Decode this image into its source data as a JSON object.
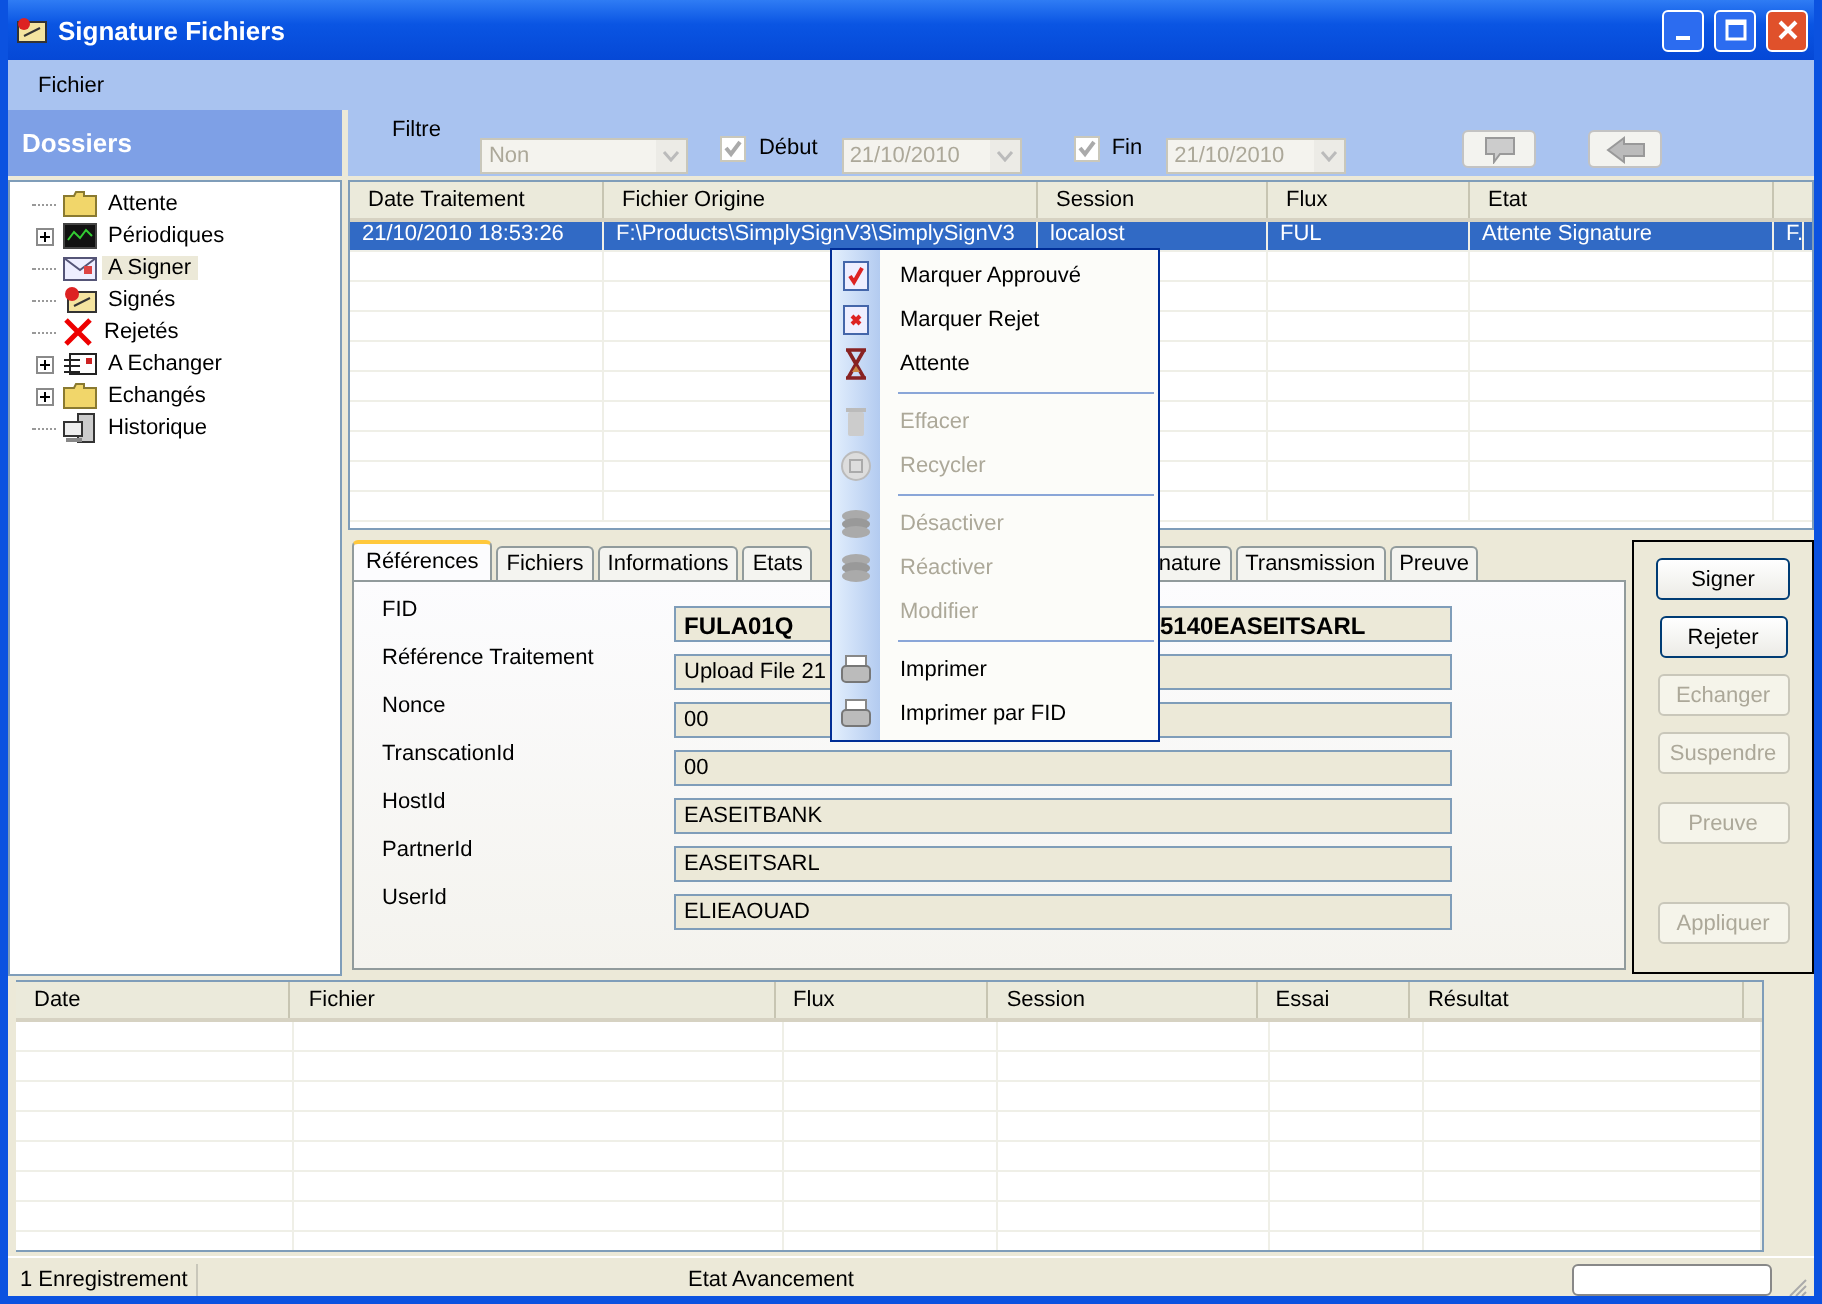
{
  "window": {
    "title": "Signature Fichiers"
  },
  "menu_bar": [
    "Fichier"
  ],
  "sidebar": {
    "title": "Dossiers",
    "items": [
      {
        "label": "Attente",
        "has_children": false,
        "selected": false
      },
      {
        "label": "Périodiques",
        "has_children": true,
        "selected": false
      },
      {
        "label": "A Signer",
        "has_children": false,
        "selected": true
      },
      {
        "label": "Signés",
        "has_children": false,
        "selected": false
      },
      {
        "label": "Rejetés",
        "has_children": false,
        "selected": false
      },
      {
        "label": "A Echanger",
        "has_children": true,
        "selected": false
      },
      {
        "label": "Echangés",
        "has_children": true,
        "selected": false
      },
      {
        "label": "Historique",
        "has_children": false,
        "selected": false
      }
    ]
  },
  "filter": {
    "label": "Filtre",
    "select": {
      "value": "Non",
      "disabled": true
    },
    "start": {
      "label": "Début",
      "checked": true,
      "date": "21/10/2010",
      "disabled": true
    },
    "end": {
      "label": "Fin",
      "checked": true,
      "date": "21/10/2010",
      "disabled": true
    }
  },
  "table": {
    "columns": [
      "Date Traitement",
      "Fichier Origine",
      "Session",
      "Flux",
      "Etat"
    ],
    "rows": [
      {
        "cells": [
          "21/10/2010 18:53:26",
          "F:\\Products\\SimplySignV3\\SimplySignV3",
          "localost",
          "FUL",
          "Attente Signature",
          "F."
        ],
        "selected": true
      }
    ]
  },
  "detail_tabs": [
    {
      "label": "Références",
      "selected": true
    },
    {
      "label": "Fichiers",
      "selected": false
    },
    {
      "label": "Informations",
      "selected": false
    },
    {
      "label": "Etats",
      "selected": false
    },
    {
      "label": "nature",
      "selected": false
    },
    {
      "label": "Transmission",
      "selected": false
    },
    {
      "label": "Preuve",
      "selected": false
    }
  ],
  "fields": [
    {
      "label": "FID",
      "value": "FULA01Q",
      "value_end": "5140EASEITSARL",
      "bold": true
    },
    {
      "label": "Référence Traitement",
      "value": "Upload File 21",
      "bold": false
    },
    {
      "label": "Nonce",
      "value": "00",
      "bold": false
    },
    {
      "label": "TranscationId",
      "value": "00",
      "bold": false
    },
    {
      "label": "HostId",
      "value": "EASEITBANK",
      "bold": false
    },
    {
      "label": "PartnerId",
      "value": "EASEITSARL",
      "bold": false
    },
    {
      "label": "UserId",
      "value": "ELIEAOUAD",
      "bold": false
    }
  ],
  "actions": [
    {
      "label": "Signer",
      "disabled": false
    },
    {
      "label": "Rejeter",
      "disabled": false
    },
    {
      "label": "Echanger",
      "disabled": true
    },
    {
      "label": "Suspendre",
      "disabled": true
    },
    {
      "label": "Preuve",
      "disabled": true
    },
    {
      "label": "Appliquer",
      "disabled": true
    }
  ],
  "log_table": {
    "columns": [
      "Date",
      "Fichier",
      "Flux",
      "Session",
      "Essai",
      "Résultat"
    ]
  },
  "status_bar": {
    "count": "1 Enregistrement",
    "progress_label": "Etat Avancement"
  },
  "context_menu": [
    {
      "kind": "item",
      "label": "Marquer Approuvé",
      "disabled": false
    },
    {
      "kind": "item",
      "label": "Marquer Rejet",
      "disabled": false
    },
    {
      "kind": "item",
      "label": "Attente",
      "disabled": false
    },
    {
      "kind": "separator"
    },
    {
      "kind": "item",
      "label": "Effacer",
      "disabled": true
    },
    {
      "kind": "item",
      "label": "Recycler",
      "disabled": true
    },
    {
      "kind": "separator"
    },
    {
      "kind": "item",
      "label": "Désactiver",
      "disabled": true
    },
    {
      "kind": "item",
      "label": "Réactiver",
      "disabled": true
    },
    {
      "kind": "item",
      "label": "Modifier",
      "disabled": true
    },
    {
      "kind": "separator"
    },
    {
      "kind": "item",
      "label": "Imprimer",
      "disabled": false
    },
    {
      "kind": "item",
      "label": "Imprimer par FID",
      "disabled": false
    }
  ]
}
